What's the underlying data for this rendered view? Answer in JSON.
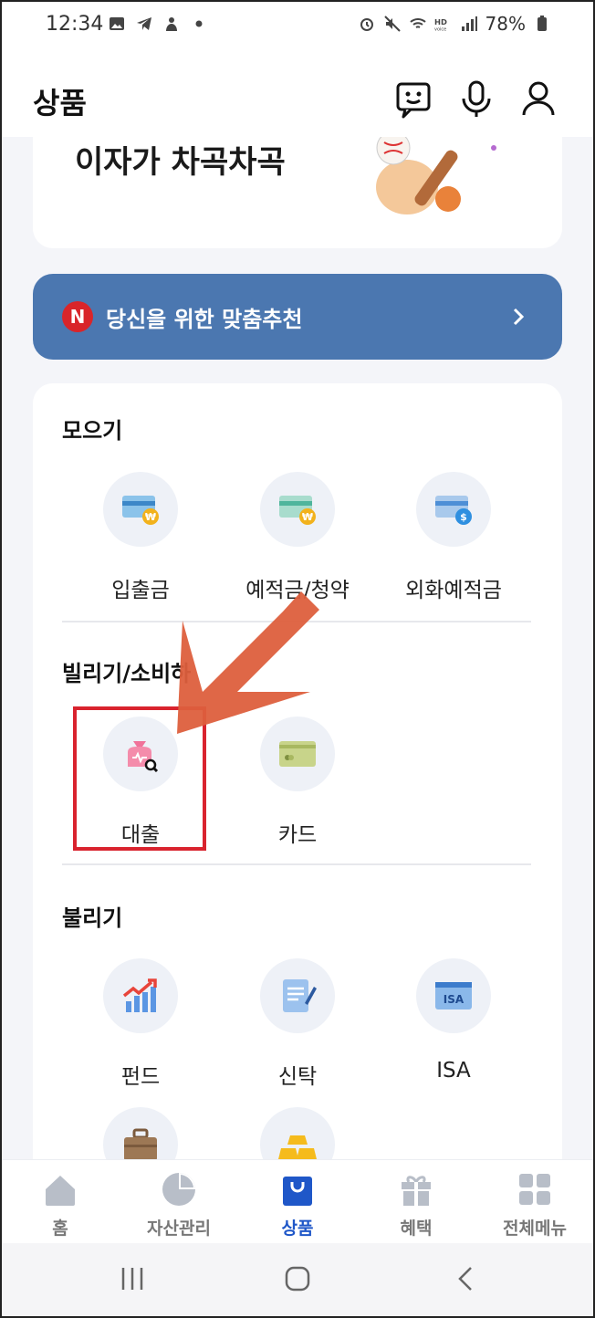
{
  "status_bar": {
    "time": "12:34",
    "battery": "78%",
    "icons_left": [
      "gallery-icon",
      "telegram-icon",
      "app-icon",
      "dot-icon"
    ],
    "icons_right": [
      "alarm-icon",
      "mute-icon",
      "wifi-icon",
      "hd-voice-icon",
      "signal-icon",
      "battery-icon"
    ]
  },
  "header": {
    "title": "상품",
    "actions": [
      "chatbot-icon",
      "microphone-icon",
      "profile-icon"
    ]
  },
  "banner": {
    "text": "이자가 차곡차곡"
  },
  "recommend": {
    "badge": "N",
    "label": "당신을 위한 맞춤추천"
  },
  "sections": [
    {
      "title": "모으기",
      "items": [
        {
          "label": "입출금",
          "icon": "bankbook-won-icon"
        },
        {
          "label": "예적금/청약",
          "icon": "savings-won-icon"
        },
        {
          "label": "외화예적금",
          "icon": "foreign-currency-icon"
        }
      ]
    },
    {
      "title": "빌리기/소비하",
      "items": [
        {
          "label": "대출",
          "icon": "loan-bag-icon"
        },
        {
          "label": "카드",
          "icon": "card-icon"
        }
      ]
    },
    {
      "title": "불리기",
      "items": [
        {
          "label": "펀드",
          "icon": "fund-chart-icon"
        },
        {
          "label": "신탁",
          "icon": "trust-document-icon"
        },
        {
          "label": "ISA",
          "icon": "isa-card-icon"
        },
        {
          "label": "",
          "icon": "briefcase-icon"
        },
        {
          "label": "",
          "icon": "gold-bars-icon"
        }
      ]
    }
  ],
  "isa_icon_text": "ISA",
  "bottom_nav": [
    {
      "label": "홈",
      "icon": "home-icon",
      "active": false
    },
    {
      "label": "자산관리",
      "icon": "pie-chart-icon",
      "active": false
    },
    {
      "label": "상품",
      "icon": "shopping-bag-icon",
      "active": true
    },
    {
      "label": "혜택",
      "icon": "gift-icon",
      "active": false
    },
    {
      "label": "전체메뉴",
      "icon": "grid-menu-icon",
      "active": false
    }
  ],
  "colors": {
    "accent": "#1f57c8",
    "recommend_bg": "#4b77b0",
    "badge": "#d9252a",
    "highlight": "#d9232e",
    "arrow": "#dd5f3d"
  }
}
